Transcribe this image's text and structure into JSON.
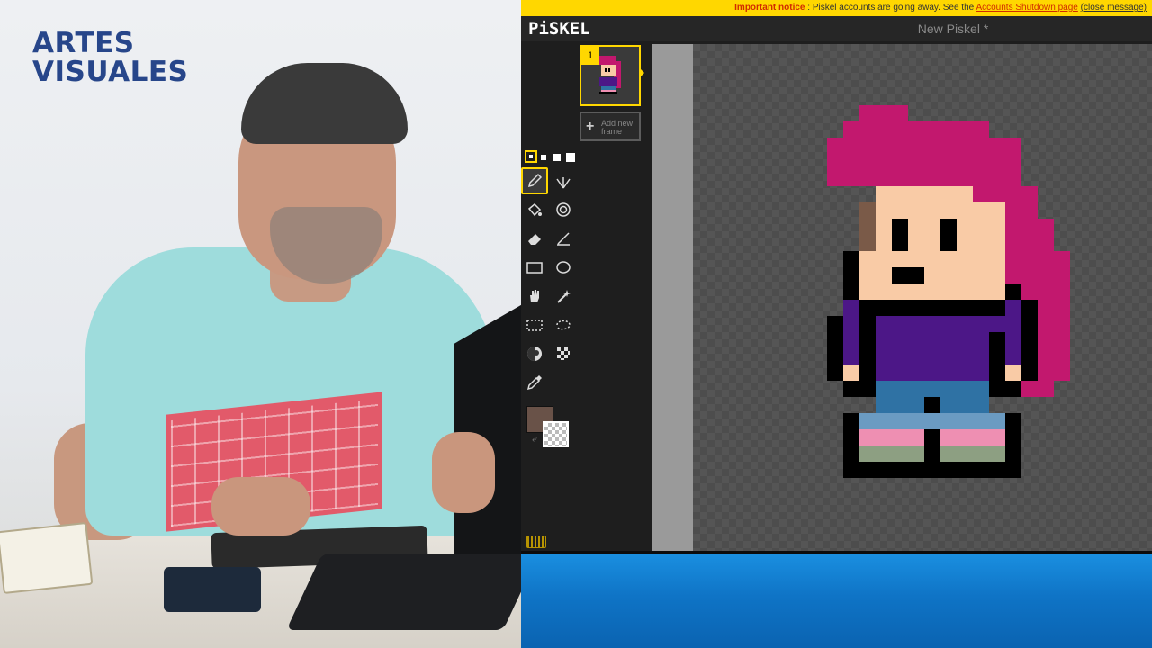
{
  "video": {
    "brand_line1": "ARTES",
    "brand_line2": "VISUALES"
  },
  "notice": {
    "title": "Important notice",
    "text": ": Piskel accounts are going away. See the",
    "link": "Accounts Shutdown page",
    "close": "(close message)"
  },
  "app": {
    "logo": "PiSKEL",
    "document_title": "New Piskel *"
  },
  "frames": {
    "items": [
      {
        "number": "1"
      }
    ],
    "add_label": "Add new frame"
  },
  "tools": [
    "pen-icon",
    "vertical-mirror-pen-icon",
    "paint-bucket-icon",
    "same-color-bucket-icon",
    "eraser-icon",
    "stroke-line-icon",
    "rectangle-icon",
    "circle-icon",
    "move-hand-icon",
    "shape-selection-wand-icon",
    "rectangle-select-icon",
    "lasso-select-icon",
    "lighten-icon",
    "dithering-icon",
    "color-picker-icon"
  ],
  "colors": {
    "primary": "#695248",
    "secondary": "transparent",
    "accent": "#ffd700",
    "hair": "#c2186e",
    "skin": "#f9cba6",
    "shirt": "#4c1787",
    "jeans": "#2f72a4"
  }
}
